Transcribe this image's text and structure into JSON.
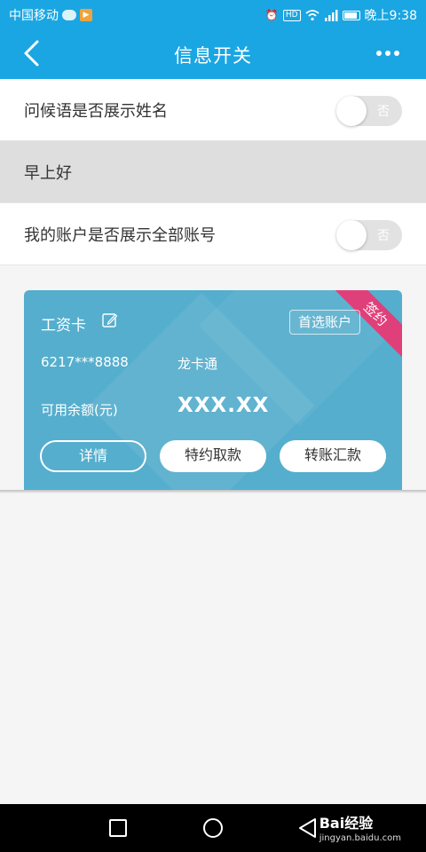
{
  "status_bar": {
    "carrier": "中国移动",
    "hd_badge": "HD",
    "time": "晚上9:38",
    "icons": [
      "wechat-icon",
      "video-app-icon",
      "alarm-icon",
      "wifi-icon",
      "signal-icon",
      "battery-icon"
    ]
  },
  "nav": {
    "title": "信息开关",
    "back_icon": "chevron-left-icon",
    "more_icon": "more-dots-icon"
  },
  "settings": {
    "show_name": {
      "label": "问候语是否展示姓名",
      "toggle_text": "否",
      "enabled": false
    },
    "greeting": {
      "text": "早上好"
    },
    "show_all_accounts": {
      "label": "我的账户是否展示全部账号",
      "toggle_text": "否",
      "enabled": false
    }
  },
  "card": {
    "name": "工资卡",
    "ribbon": "签约",
    "primary_tag": "首选账户",
    "account_number": "6217***8888",
    "account_type": "龙卡通",
    "balance_label": "可用余额(元)",
    "balance_value": "XXX.XX",
    "buttons": {
      "details": "详情",
      "special_withdraw": "特约取款",
      "transfer": "转账汇款"
    },
    "color": "#55aecd",
    "ribbon_color": "#e0407a"
  },
  "system_nav": {
    "watermark": "Bai经验",
    "watermark_url": "jingyan.baidu.com"
  },
  "colors": {
    "accent": "#1aa6e2",
    "background": "#f5f5f5"
  }
}
